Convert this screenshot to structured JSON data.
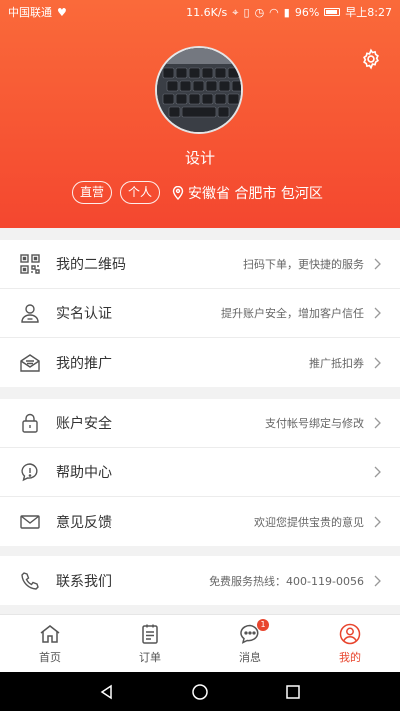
{
  "status_bar": {
    "carrier": "中国联通",
    "speed": "11.6K/s",
    "battery": "96%",
    "time": "早上8:27"
  },
  "profile": {
    "nickname": "设计",
    "tags": [
      "直营",
      "个人"
    ],
    "location": "安徽省 合肥市 包河区"
  },
  "menu_groups": [
    [
      {
        "title": "我的二维码",
        "desc": "扫码下单，更快捷的服务",
        "icon": "qrcode-icon"
      },
      {
        "title": "实名认证",
        "desc": "提升账户安全，增加客户信任",
        "icon": "user-verify-icon"
      },
      {
        "title": "我的推广",
        "desc": "推广抵扣券",
        "icon": "promotion-mail-icon"
      }
    ],
    [
      {
        "title": "账户安全",
        "desc": "支付帐号绑定与修改",
        "icon": "lock-icon"
      },
      {
        "title": "帮助中心",
        "desc": "",
        "icon": "help-bubble-icon"
      },
      {
        "title": "意见反馈",
        "desc": "欢迎您提供宝贵的意见",
        "icon": "envelope-icon"
      }
    ],
    [
      {
        "title": "联系我们",
        "desc": "免费服务热线：400-119-0056",
        "icon": "phone-icon"
      }
    ]
  ],
  "tabs": [
    {
      "label": "首页",
      "icon": "home-icon"
    },
    {
      "label": "订单",
      "icon": "order-icon"
    },
    {
      "label": "消息",
      "icon": "message-icon",
      "badge": "1"
    },
    {
      "label": "我的",
      "icon": "profile-icon",
      "active": true
    }
  ],
  "colors": {
    "accent": "#e8452e",
    "header_top": "#fa6a3a",
    "header_bottom": "#f4472f"
  }
}
